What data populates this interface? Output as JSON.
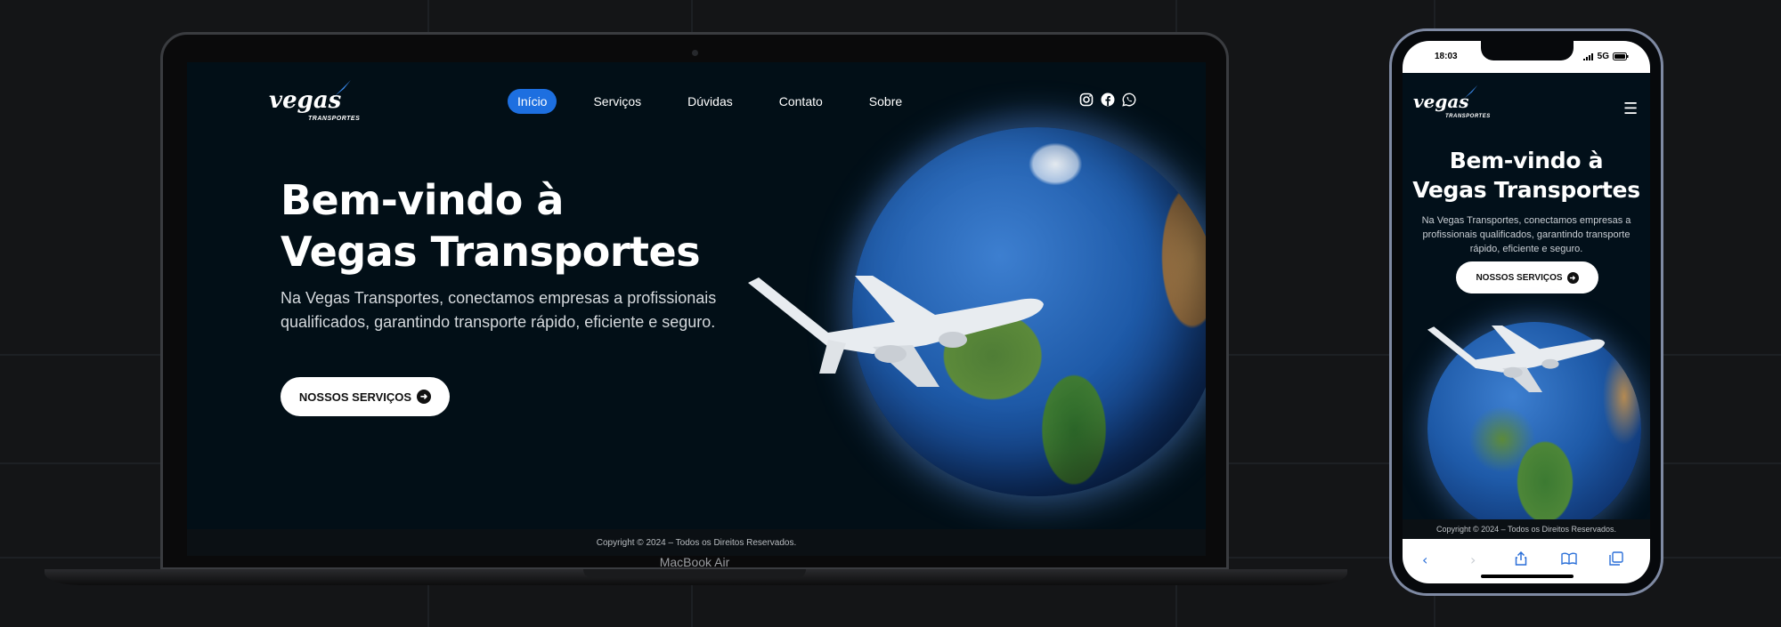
{
  "site": {
    "logo_text": "vegas",
    "logo_sub": "TRANSPORTES",
    "nav": [
      {
        "label": "Início",
        "active": true
      },
      {
        "label": "Serviços",
        "active": false
      },
      {
        "label": "Dúvidas",
        "active": false
      },
      {
        "label": "Contato",
        "active": false
      },
      {
        "label": "Sobre",
        "active": false
      }
    ],
    "social_icons": [
      "instagram-icon",
      "facebook-icon",
      "whatsapp-icon"
    ],
    "hero": {
      "title_line1": "Bem-vindo à",
      "title_line2": "Vegas Transportes",
      "description": "Na Vegas Transportes, conectamos empresas a profissionais qualificados, garantindo transporte rápido, eficiente e seguro.",
      "cta_label": "NOSSOS SERVIÇOS"
    },
    "footer": "Copyright © 2024 – Todos os Direitos Reservados.",
    "colors": {
      "accent": "#1d6fe0",
      "background": "#020f17"
    }
  },
  "device": {
    "laptop_label": "MacBook Air"
  },
  "phone": {
    "time": "18:03",
    "network": "5G",
    "menu_icon": "hamburger-icon",
    "toolbar_icons": [
      "back-icon",
      "forward-icon",
      "share-icon",
      "bookmarks-icon",
      "tabs-icon"
    ]
  }
}
